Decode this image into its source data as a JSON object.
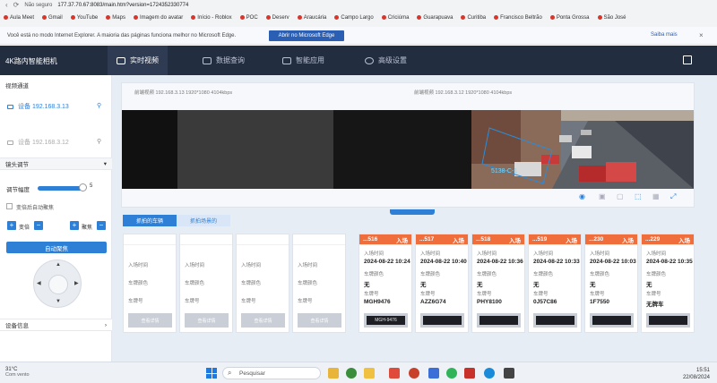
{
  "browser": {
    "security": "Não seguro",
    "url": "177.37.70.67:8083/main.htm?version=1724352330774",
    "bookmarks": [
      "Aula Meet",
      "Gmail",
      "YouTube",
      "Maps",
      "Imagem do avatar",
      "Início - Roblox",
      "POC",
      "Deserv",
      "Araucária",
      "Campo Largo",
      "Criciúma",
      "Guarapuava",
      "Curitiba",
      "Francisco Beltrão",
      "Ponta Grossa",
      "São José"
    ]
  },
  "ie_bar": {
    "message": "Você está no modo Internet Explorer. A maioria das páginas funciona melhor no Microsoft Edge.",
    "button": "Abrir no Microsoft Edge",
    "later": "Saiba mais",
    "close": "×"
  },
  "app": {
    "title": "4K路内智能相机",
    "tabs": [
      {
        "label": "实时视频",
        "icon": "video-icon"
      },
      {
        "label": "数据查询",
        "icon": "save-icon"
      },
      {
        "label": "智能应用",
        "icon": "sliders-icon"
      },
      {
        "label": "高级设置",
        "icon": "settings-icon"
      }
    ]
  },
  "sidebar": {
    "channel_header": "视频通道",
    "cameras": [
      {
        "label": "设备 192.168.3.13",
        "active": true
      },
      {
        "label": "设备 192.168.3.12",
        "active": false
      }
    ],
    "lens_header": "镜头调节",
    "zoom_label": "调节幅度",
    "zoom_value": "5",
    "auto_focus_label": "变倍后自动聚焦",
    "zoom_ctrl": "变倍",
    "focus_ctrl": "聚焦",
    "auto_focus_button": "自动聚焦",
    "device_info": "设备信息"
  },
  "video": {
    "left_label": "前端视频 192.168.3.13 1920*1080 4104kbps",
    "right_label": "前端视频 192.168.3.12 1920*1080 4104kbps",
    "scene_text": "5138-C-1"
  },
  "records": {
    "subtabs": [
      "抓拍的车辆",
      "抓拍场景的"
    ],
    "labels": {
      "time": "入场时间",
      "plate_color": "车牌颜色",
      "plate_no": "车牌号",
      "details": "查看详情",
      "direction": "入场"
    },
    "empty_count": 4,
    "cards": [
      {
        "id": "...516",
        "time": "2024-08-22 10:24",
        "color": "无",
        "plate": "MGH9476",
        "image_text": "MGH-9476"
      },
      {
        "id": "...517",
        "time": "2024-08-22 10:40",
        "color": "无",
        "plate": "AZZ6G74",
        "image_text": ""
      },
      {
        "id": "...518",
        "time": "2024-08-22 10:36",
        "color": "无",
        "plate": "PHY8100",
        "image_text": ""
      },
      {
        "id": "...519",
        "time": "2024-08-22 10:33",
        "color": "无",
        "plate": "0J57C86",
        "image_text": ""
      },
      {
        "id": "...230",
        "time": "2024-08-22 10:03",
        "color": "无",
        "plate": "1F7550",
        "image_text": ""
      },
      {
        "id": "...229",
        "time": "2024-08-22 10:35",
        "color": "无",
        "plate": "无牌车",
        "image_text": ""
      }
    ]
  },
  "taskbar": {
    "weather_temp": "31°C",
    "weather_desc": "Com vento",
    "search": "Pesquisar",
    "time": "15:51",
    "date": "22/08/2024"
  }
}
